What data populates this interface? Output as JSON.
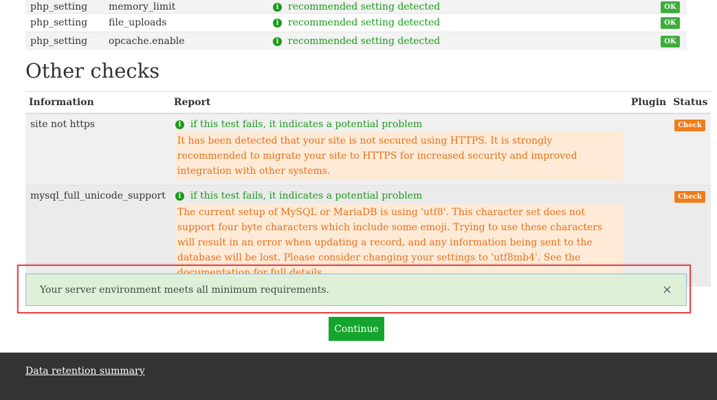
{
  "php_settings": [
    {
      "type": "php_setting",
      "name": "memory_limit",
      "message": "recommended setting detected",
      "status": "OK"
    },
    {
      "type": "php_setting",
      "name": "file_uploads",
      "message": "recommended setting detected",
      "status": "OK"
    },
    {
      "type": "php_setting",
      "name": "opcache.enable",
      "message": "recommended setting detected",
      "status": "OK"
    }
  ],
  "other_checks": {
    "heading": "Other checks",
    "columns": {
      "information": "Information",
      "report": "Report",
      "plugin": "Plugin",
      "status": "Status"
    },
    "rows": [
      {
        "information": "site not https",
        "notice": "if this test fails, it indicates a potential problem",
        "detail": "It has been detected that your site is not secured using HTTPS. It is strongly recommended to migrate your site to HTTPS for increased security and improved integration with other systems.",
        "status": "Check"
      },
      {
        "information": "mysql_full_unicode_support",
        "notice": "if this test fails, it indicates a potential problem",
        "detail": "The current setup of MySQL or MariaDB is using 'utf8'. This character set does not support four byte characters which include some emoji. Trying to use these characters will result in an error when updating a record, and any information being sent to the database will be lost. Please consider changing your settings to 'utf8mb4'. See the documentation for full details.",
        "status": "Check"
      }
    ]
  },
  "alert": {
    "message": "Your server environment meets all minimum requirements.",
    "close": "×"
  },
  "continue_label": "Continue",
  "footer": {
    "link": "Data retention summary"
  },
  "icons": {
    "info": "info-circle-icon",
    "close": "close-icon"
  },
  "colors": {
    "ok": "#3cae3c",
    "check": "#f07c1b",
    "continue": "#14a52e",
    "alert_bg": "#dff0d8",
    "footer": "#333333"
  }
}
